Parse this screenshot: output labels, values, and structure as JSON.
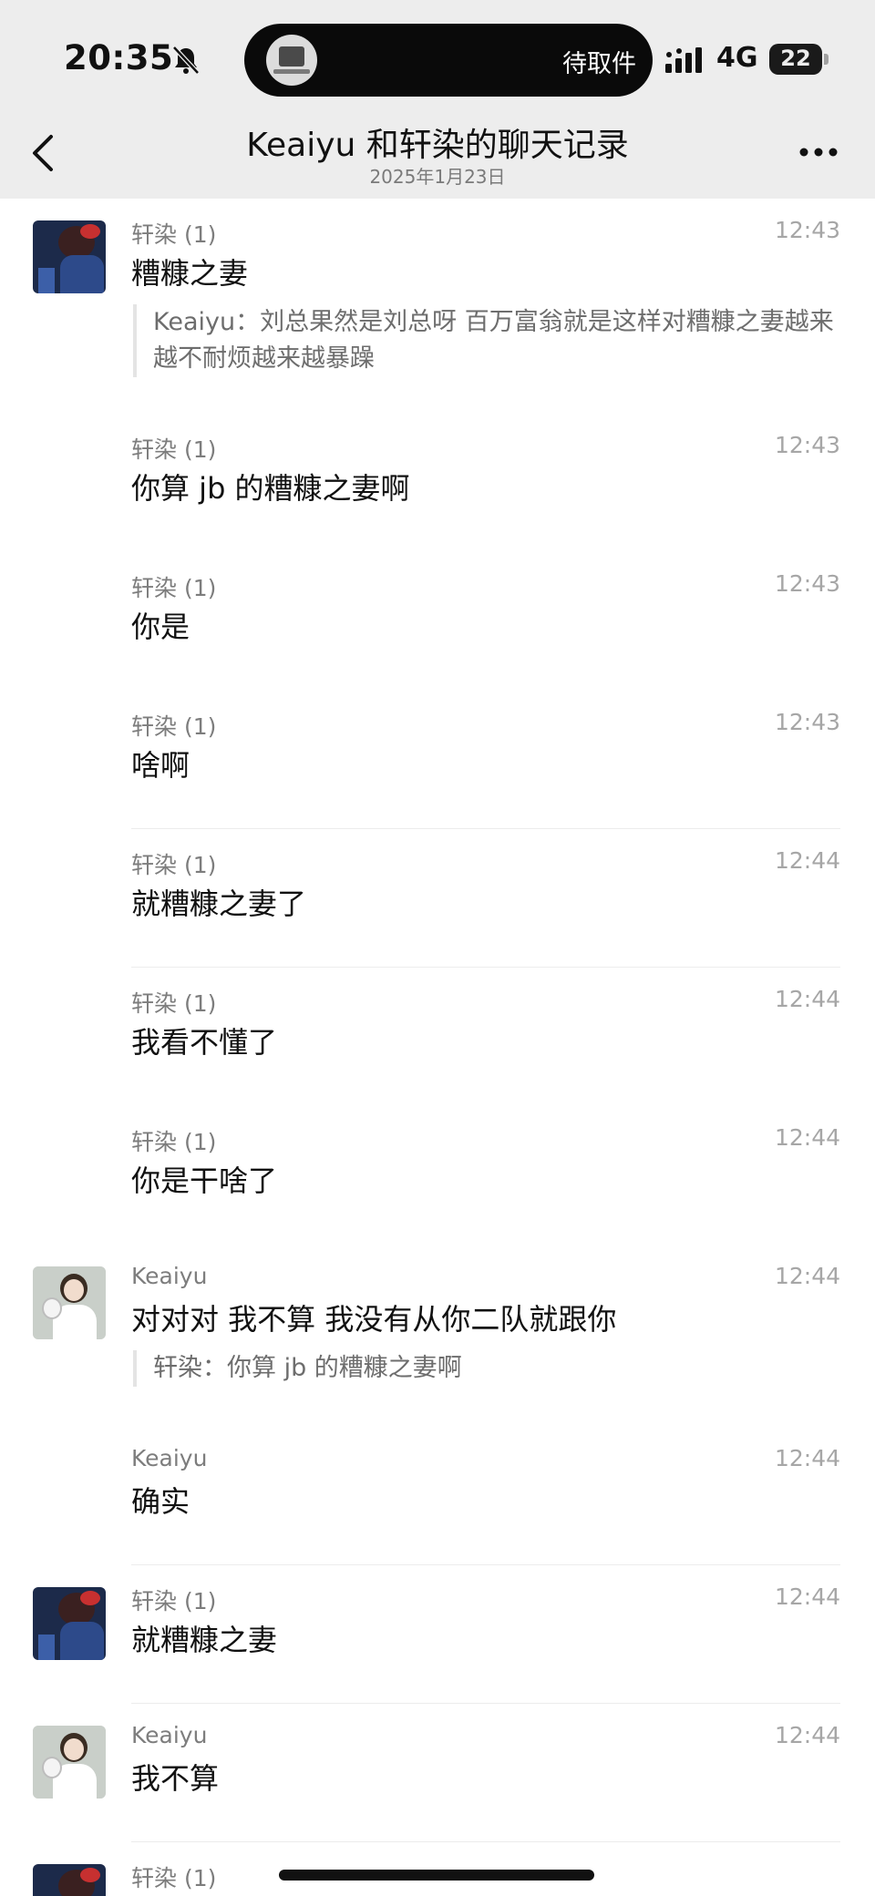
{
  "status_bar": {
    "time": "20:35",
    "island_text": "待取件",
    "network": "4G",
    "battery": "22"
  },
  "nav": {
    "title": "Keaiyu 和轩染的聊天记录",
    "date": "2025年1月23日"
  },
  "messages": [
    {
      "sender": "轩染 (1)",
      "time": "12:43",
      "text": "糟糠之妻",
      "quote": "Keaiyu：刘总果然是刘总呀 百万富翁就是这样对糟糠之妻越来越不耐烦越来越暴躁",
      "avatar": "dark"
    },
    {
      "sender": "轩染 (1)",
      "time": "12:43",
      "text": "你算 jb 的糟糠之妻啊"
    },
    {
      "sender": "轩染 (1)",
      "time": "12:43",
      "text": "你是"
    },
    {
      "sender": "轩染 (1)",
      "time": "12:43",
      "text": "啥啊"
    },
    {
      "sender": "轩染 (1)",
      "time": "12:44",
      "text": "就糟糠之妻了"
    },
    {
      "sender": "轩染 (1)",
      "time": "12:44",
      "text": "我看不懂了"
    },
    {
      "sender": "轩染 (1)",
      "time": "12:44",
      "text": "你是干啥了"
    },
    {
      "sender": "Keaiyu",
      "time": "12:44",
      "text": "对对对 我不算 我没有从你二队就跟你",
      "quote": "轩染：你算 jb 的糟糠之妻啊",
      "avatar": "light"
    },
    {
      "sender": "Keaiyu",
      "time": "12:44",
      "text": "确实"
    },
    {
      "sender": "轩染 (1)",
      "time": "12:44",
      "text": "就糟糠之妻",
      "avatar": "dark"
    },
    {
      "sender": "Keaiyu",
      "time": "12:44",
      "text": "我不算",
      "avatar": "light"
    },
    {
      "sender": "轩染 (1)",
      "time": "",
      "text": "",
      "avatar": "dark"
    }
  ],
  "icons": {
    "bell": "bell-muted-icon",
    "back": "chevron-left-icon",
    "more": "more-dots-icon",
    "signal": "signal-bars-icon",
    "battery": "battery-icon"
  }
}
